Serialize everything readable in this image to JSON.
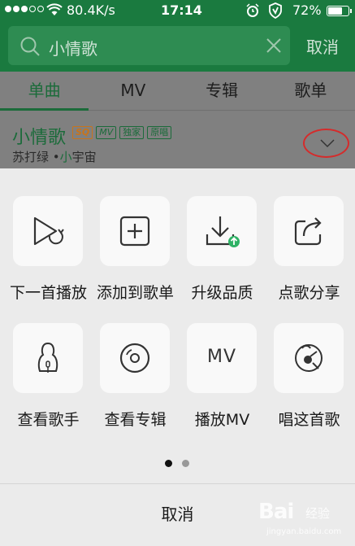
{
  "status_bar": {
    "speed": "80.4K/s",
    "time": "17:14",
    "battery": "72%",
    "battery_level": 0.72,
    "signal_bars_filled": 3,
    "signal_bars_total": 5
  },
  "search": {
    "query": "小情歌",
    "cancel_label": "取消"
  },
  "tabs": [
    {
      "label": "单曲",
      "active": true
    },
    {
      "label": "MV",
      "active": false
    },
    {
      "label": "专辑",
      "active": false
    },
    {
      "label": "歌单",
      "active": false
    }
  ],
  "song": {
    "title": "小情歌",
    "tags": [
      "SQ",
      "MV",
      "独家",
      "原唱"
    ],
    "artist": "苏打绿",
    "separator": "•",
    "album_prefix": "小",
    "album_rest": "宇宙"
  },
  "actions": [
    {
      "label": "下一首播放",
      "icon": "play-next-icon"
    },
    {
      "label": "添加到歌单",
      "icon": "add-to-playlist-icon"
    },
    {
      "label": "升级品质",
      "icon": "upgrade-quality-icon"
    },
    {
      "label": "点歌分享",
      "icon": "share-icon"
    },
    {
      "label": "查看歌手",
      "icon": "singer-icon"
    },
    {
      "label": "查看专辑",
      "icon": "album-icon"
    },
    {
      "label": "播放MV",
      "icon": "mv-icon",
      "icon_text": "MV"
    },
    {
      "label": "唱这首歌",
      "icon": "sing-icon"
    }
  ],
  "pager": {
    "current": 1,
    "total": 2
  },
  "sheet_cancel_label": "取消",
  "watermark": {
    "brand": "Bai",
    "sub": "经验",
    "url": "jingyan.baidu.com"
  },
  "colors": {
    "brand_green": "#1a7a3f",
    "active_tab": "#1b6b3a",
    "highlight_circle": "#d52b2b",
    "sq_tag": "#c8741b"
  }
}
